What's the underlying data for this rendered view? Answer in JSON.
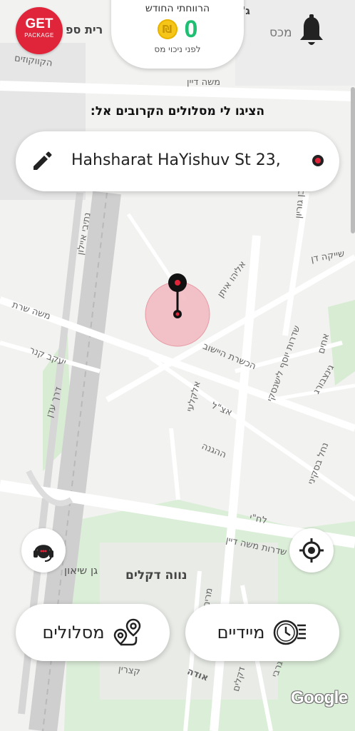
{
  "logo": {
    "line1": "GET",
    "line2": "PACKAGE"
  },
  "earnings": {
    "title": "הרווחתי החודש",
    "currency_symbol": "₪",
    "amount": "0",
    "subtitle": "לפני ניכוי מס"
  },
  "search": {
    "prompt": "הציגו לי מסלולים הקרובים אל:",
    "address": "Hahsharat HaYishuv St 23,"
  },
  "map": {
    "streets": [
      "ג'סי",
      "מכס",
      "רית ספ",
      "הקווקוזים",
      "משה דיין",
      "נתיבי איילון",
      "בן גוריון",
      "שייקה דן",
      "אליהו איתן",
      "משה שרת",
      "יעקב קנר",
      "דרך עדן",
      "הכשרת היישוב",
      "שדרות יוסף לישנסקי",
      "אצ\"ל",
      "אלקלעי",
      "ההגנה",
      "אחים",
      "גינצבורג",
      "נחל בסקיני",
      "לח\"י",
      "שדרות משה דיין",
      "גן שיאון",
      "נווה דקלים",
      "מרים",
      "קצרין",
      "אודה",
      "דקלים",
      "גרבי"
    ],
    "google_label": "Google"
  },
  "buttons": {
    "routes_label": "מסלולים",
    "immediate_label": "מיידיים"
  },
  "colors": {
    "brand_red": "#e0243a",
    "earnings_green": "#1fbf73",
    "coin_gold": "#f5c518"
  },
  "icons": [
    "bell-icon",
    "pencil-icon",
    "pin-icon",
    "support-icon",
    "crosshair-icon",
    "route-pin-icon",
    "clock-fast-icon"
  ]
}
